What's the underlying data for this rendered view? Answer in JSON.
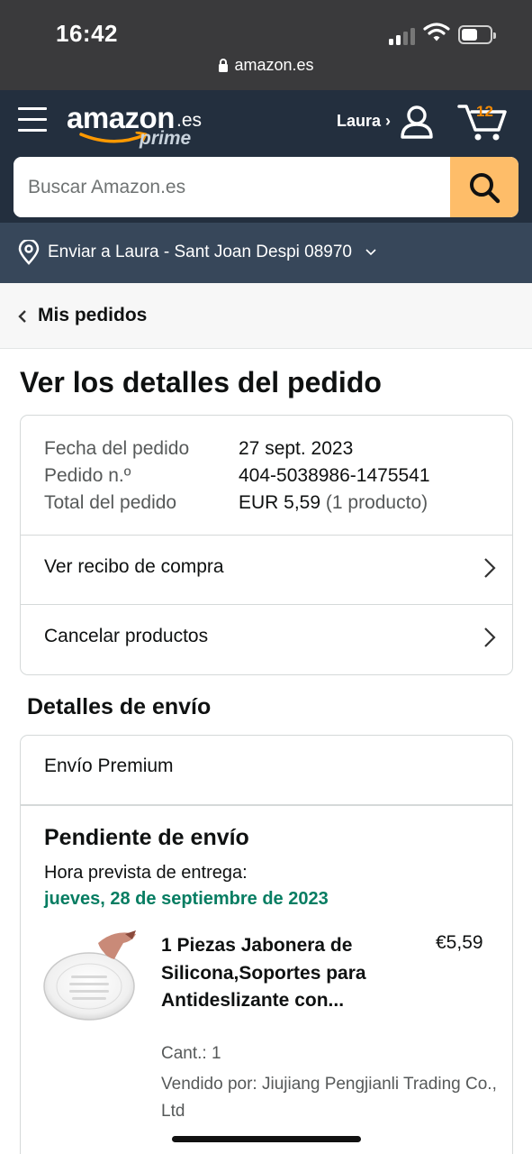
{
  "status_bar": {
    "time": "16:42",
    "url": "amazon.es"
  },
  "header": {
    "logo": {
      "word": "amazon",
      "tld": ".es",
      "sub": "prime"
    },
    "account_label": "Laura ›",
    "cart_count": "12",
    "search": {
      "placeholder": "Buscar Amazon.es"
    }
  },
  "deliver_to": "Enviar a Laura - Sant Joan Despi 08970",
  "breadcrumb": "Mis pedidos",
  "page_title": "Ver los detalles del pedido",
  "order_info": {
    "date_label": "Fecha del pedido",
    "date_value": "27 sept. 2023",
    "number_label": "Pedido n.º",
    "number_value": "404-5038986-1475541",
    "total_label": "Total del pedido",
    "total_value": "EUR 5,59",
    "total_count": "(1 producto)"
  },
  "actions": {
    "receipt": "Ver recibo de compra",
    "cancel": "Cancelar productos"
  },
  "shipping": {
    "section_title": "Detalles de envío",
    "type": "Envío Premium",
    "status": "Pendiente de envío",
    "eta_label": "Hora prevista de entrega:",
    "eta_value": "jueves, 28 de septiembre de 2023"
  },
  "item": {
    "title": "1 Piezas Jabonera de Silicona,Soportes para Antideslizante con...",
    "price": "€5,59",
    "quantity": "Cant.: 1",
    "seller": "Vendido por: Jiujiang Pengjianli Trading Co., Ltd"
  },
  "colors": {
    "header_bg": "#232f3e",
    "deliver_bg": "#37475a",
    "search_button": "#febd69",
    "cart_count": "#f08804",
    "eta_green": "#067d62"
  }
}
